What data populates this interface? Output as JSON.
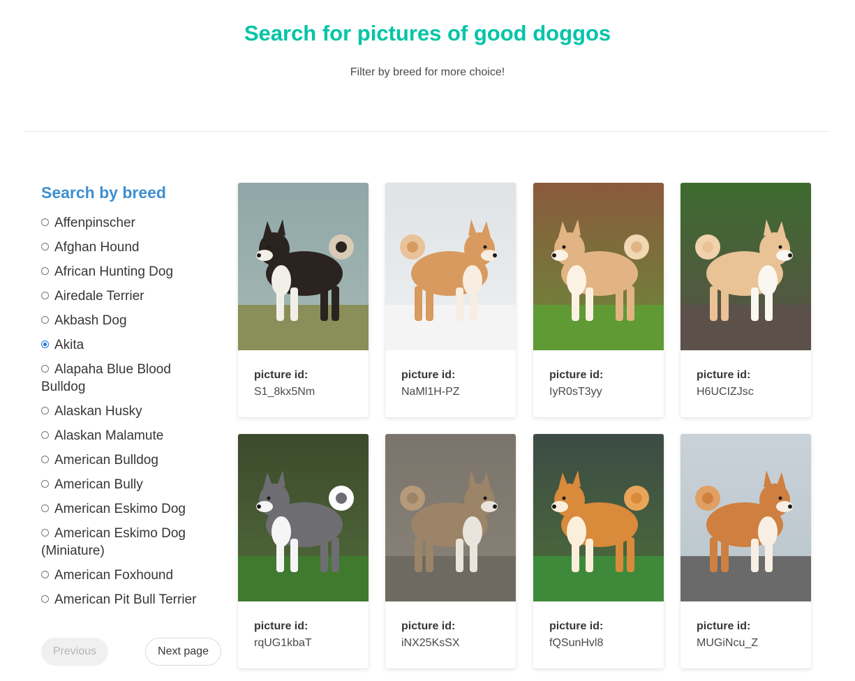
{
  "hero": {
    "title": "Search for pictures of good doggos",
    "subtitle": "Filter by breed for more choice!"
  },
  "sidebar": {
    "title": "Search by breed",
    "breeds": [
      {
        "label": "Affenpinscher",
        "checked": false
      },
      {
        "label": "Afghan Hound",
        "checked": false
      },
      {
        "label": "African Hunting Dog",
        "checked": false
      },
      {
        "label": "Airedale Terrier",
        "checked": false
      },
      {
        "label": "Akbash Dog",
        "checked": false
      },
      {
        "label": "Akita",
        "checked": true
      },
      {
        "label": "Alapaha Blue Blood Bulldog",
        "checked": false
      },
      {
        "label": "Alaskan Husky",
        "checked": false
      },
      {
        "label": "Alaskan Malamute",
        "checked": false
      },
      {
        "label": "American Bulldog",
        "checked": false
      },
      {
        "label": "American Bully",
        "checked": false
      },
      {
        "label": "American Eskimo Dog",
        "checked": false
      },
      {
        "label": "American Eskimo Dog (Miniature)",
        "checked": false
      },
      {
        "label": "American Foxhound",
        "checked": false
      },
      {
        "label": "American Pit Bull Terrier",
        "checked": false
      }
    ]
  },
  "pager": {
    "previous_label": "Previous",
    "next_label": "Next page"
  },
  "cards": [
    {
      "label": "picture id:",
      "id": "S1_8kx5Nm",
      "image": "akita-black-white-photo"
    },
    {
      "label": "picture id:",
      "id": "NaMl1H-PZ",
      "image": "akita-red-snow-photo"
    },
    {
      "label": "picture id:",
      "id": "IyR0sT3yy",
      "image": "akita-red-grass-photo"
    },
    {
      "label": "picture id:",
      "id": "H6UCIZJsc",
      "image": "akita-lying-deck-photo"
    },
    {
      "label": "picture id:",
      "id": "rqUG1kbaT",
      "image": "akita-grey-closeup-photo"
    },
    {
      "label": "picture id:",
      "id": "iNX25KsSX",
      "image": "akita-brindle-photo"
    },
    {
      "label": "picture id:",
      "id": "fQSunHvl8",
      "image": "shiba-turf-photo"
    },
    {
      "label": "picture id:",
      "id": "MUGiNcu_Z",
      "image": "akita-pebble-beach-photo"
    }
  ],
  "colors": {
    "title_accent": "#00c4a7",
    "sidebar_title": "#3e8ed0",
    "radio_checked": "#1a73e8"
  }
}
